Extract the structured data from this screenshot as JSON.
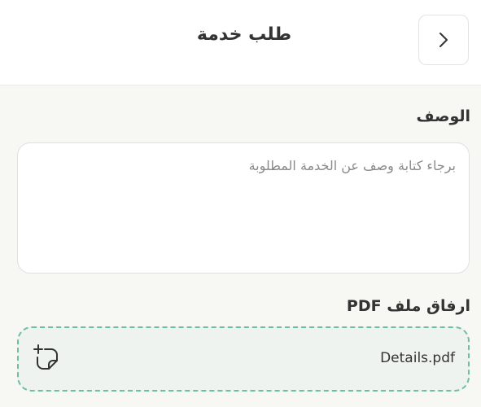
{
  "header": {
    "title": "طلب خدمة"
  },
  "description": {
    "label": "الوصف",
    "placeholder": "برجاء كتابة وصف عن الخدمة المطلوبة",
    "value": ""
  },
  "attachment": {
    "label": "ارفاق ملف PDF",
    "file_name": "Details.pdf"
  },
  "colors": {
    "accent_dashed_border": "#6dbfa0",
    "background": "#f7f7f3",
    "file_box_background": "#eef3ef"
  },
  "icons": {
    "back": "chevron-right-icon",
    "attach": "add-file-icon"
  }
}
